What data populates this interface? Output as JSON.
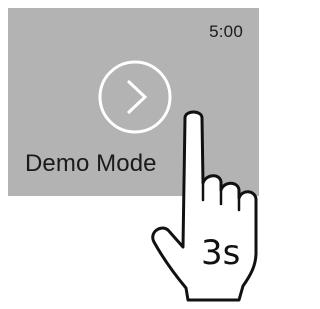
{
  "screen": {
    "time": "5:00",
    "mode_label": "Demo Mode",
    "background_color": "#b3b3b3"
  },
  "start_button": {
    "icon": "chevron-right-icon",
    "color": "#ffffff"
  },
  "gesture": {
    "icon": "pointing-hand-icon",
    "hold_label": "3s"
  }
}
